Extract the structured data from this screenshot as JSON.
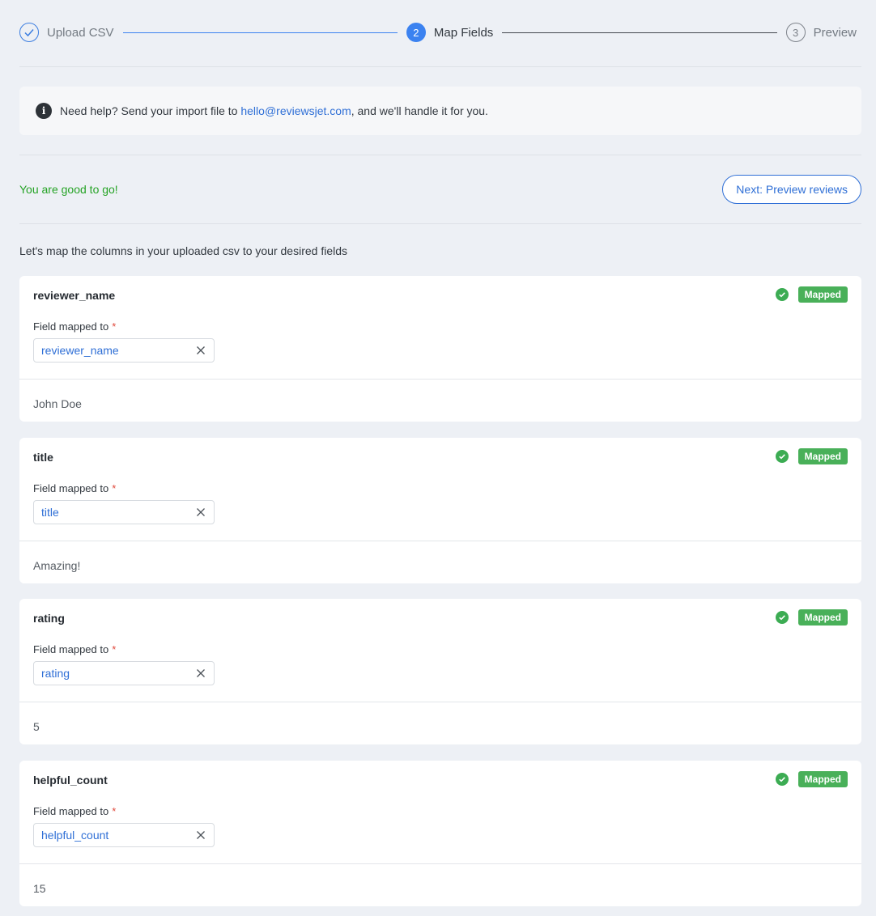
{
  "stepper": {
    "steps": [
      {
        "label": "Upload CSV",
        "number": "1",
        "state": "done"
      },
      {
        "label": "Map Fields",
        "number": "2",
        "state": "active"
      },
      {
        "label": "Preview",
        "number": "3",
        "state": "todo"
      }
    ]
  },
  "help": {
    "text_before": "Need help? Send your import file to ",
    "email": "hello@reviewsjet.com",
    "text_after": ", and we'll handle it for you."
  },
  "status": {
    "message": "You are good to go!",
    "next_button": "Next: Preview reviews"
  },
  "intro": "Let's map the columns in your uploaded csv to your desired fields",
  "fields": [
    {
      "column": "reviewer_name",
      "badge": "Mapped",
      "label": "Field mapped to",
      "required": "*",
      "mapped_to": "reviewer_name",
      "sample": "John Doe"
    },
    {
      "column": "title",
      "badge": "Mapped",
      "label": "Field mapped to",
      "required": "*",
      "mapped_to": "title",
      "sample": "Amazing!"
    },
    {
      "column": "rating",
      "badge": "Mapped",
      "label": "Field mapped to",
      "required": "*",
      "mapped_to": "rating",
      "sample": "5"
    },
    {
      "column": "helpful_count",
      "badge": "Mapped",
      "label": "Field mapped to",
      "required": "*",
      "mapped_to": "helpful_count",
      "sample": "15"
    }
  ],
  "colors": {
    "accent": "#3b82f0",
    "link": "#2f6fd6",
    "success": "#25a325",
    "badge": "#49b059",
    "required": "#e04a3d"
  }
}
